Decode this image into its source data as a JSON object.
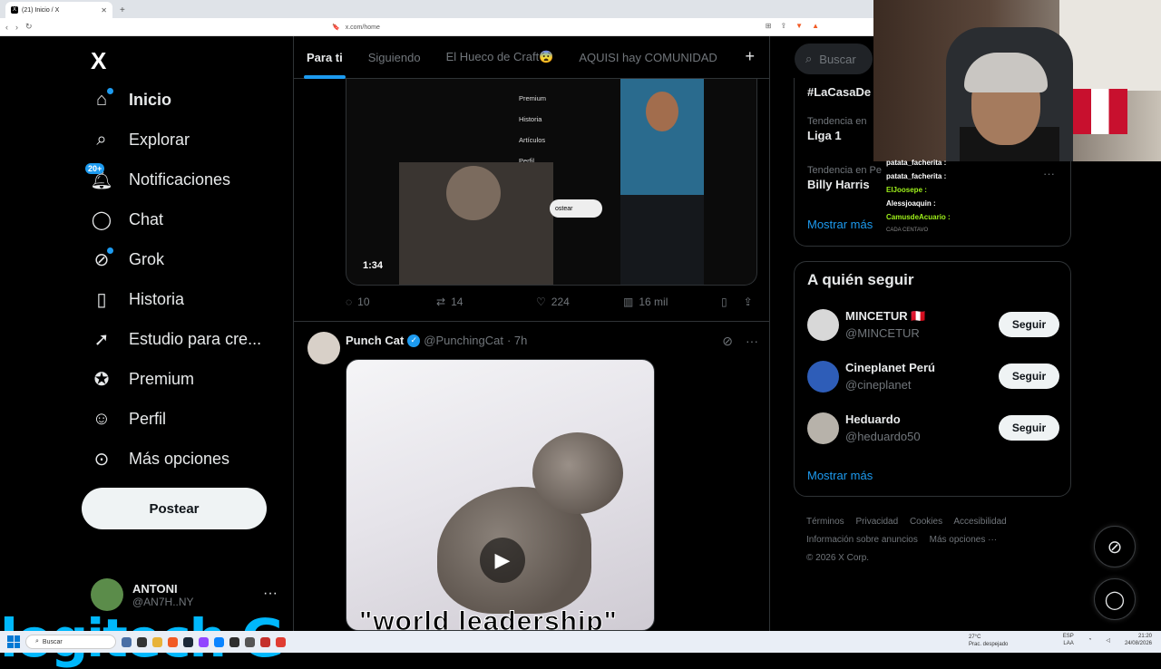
{
  "browser": {
    "tab_title": "(21) Inicio / X",
    "url": "x.com/home"
  },
  "sidebar": {
    "logo": "X",
    "items": [
      {
        "label": "Inicio",
        "icon": "home-icon"
      },
      {
        "label": "Explorar",
        "icon": "search-icon"
      },
      {
        "label": "Notificaciones",
        "icon": "bell-icon",
        "badge": "20+"
      },
      {
        "label": "Chat",
        "icon": "chat-icon"
      },
      {
        "label": "Grok",
        "icon": "grok-icon"
      },
      {
        "label": "Historia",
        "icon": "bookmark-icon"
      },
      {
        "label": "Estudio para cre...",
        "icon": "rocket-icon"
      },
      {
        "label": "Premium",
        "icon": "premium-icon"
      },
      {
        "label": "Perfil",
        "icon": "user-icon"
      },
      {
        "label": "Más opciones",
        "icon": "more-icon"
      }
    ],
    "post_button": "Postear",
    "account": {
      "name": "ANTONI",
      "handle": "@AN7H..NY"
    }
  },
  "overlay_brand": "logitech G",
  "feed": {
    "tabs": [
      "Para ti",
      "Siguiendo",
      "El Hueco de Craft😨",
      "AQUISI hay COMUNIDAD"
    ],
    "tweet1": {
      "video_duration": "1:34",
      "menu_items": [
        "Premium",
        "Historia",
        "Artículos",
        "Perfil",
        "opciones"
      ],
      "publish_label": "ostear",
      "replies": "10",
      "reposts": "14",
      "likes": "224",
      "views": "16 mil"
    },
    "tweet2": {
      "name": "Punch Cat",
      "handle": "@PunchingCat",
      "time": "· 7h",
      "caption": "\"world leadership\""
    }
  },
  "right": {
    "search_placeholder": "Buscar",
    "trends": [
      {
        "category": "",
        "name": "#LaCasaDe"
      },
      {
        "category": "Tendencia en",
        "name": "Liga 1"
      },
      {
        "category": "Tendencia en Pe",
        "name": "Billy Harris"
      }
    ],
    "trends_more": "Mostrar más",
    "follow_title": "A quién seguir",
    "follow": [
      {
        "name": "MINCETUR 🇵🇪",
        "handle": "@MINCETUR",
        "button": "Seguir",
        "avatar_color": "#cfcfcf"
      },
      {
        "name": "Cineplanet Perú",
        "handle": "@cineplanet",
        "button": "Seguir",
        "avatar_color": "#2e5db8"
      },
      {
        "name": "Heduardo",
        "handle": "@heduardo50",
        "button": "Seguir",
        "avatar_color": "#b7b2aa"
      }
    ],
    "follow_more": "Mostrar más",
    "footer": [
      "Términos",
      "Privacidad",
      "Cookies",
      "Accesibilidad",
      "Información sobre anuncios",
      "Más opciones ···",
      "© 2026 X Corp."
    ]
  },
  "stream_chat": [
    {
      "user": "patata_facherita :",
      "style": "u1"
    },
    {
      "user": "patata_facherita :",
      "style": "u1"
    },
    {
      "user": "ElJoosepe :",
      "style": "u2"
    },
    {
      "user": "Alessjoaquin :",
      "style": "u1"
    },
    {
      "user": "CamusdeAcuario :",
      "style": "u2"
    }
  ],
  "chat_footer": "CADA CENTAVO",
  "taskbar": {
    "search": "Buscar",
    "weather_temp": "27°C",
    "weather_desc": "Prac. despejado",
    "lang": "ESP",
    "lang2": "LAA",
    "time": "21:20",
    "date": "24/08/2026"
  }
}
